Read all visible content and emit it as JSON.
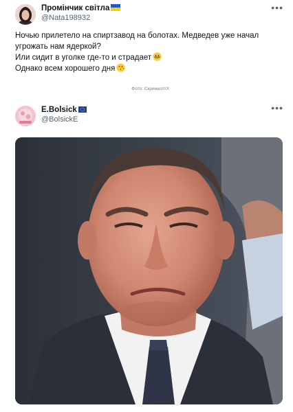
{
  "tweet1": {
    "display_name": "Промінчик світла",
    "handle": "@Nata198932",
    "lines": [
      "Ночью прилетело на спиртзавод на болотах. Медведев уже начал",
      "угрожать нам ядеркой?",
      "Или сидит в уголке где-то и страдает",
      "Однако всем хорошего дня"
    ],
    "emojis": [
      "grinning-face-emoji",
      "winking-kiss-emoji"
    ],
    "photo_credit": "Фото: Скриншот/X",
    "flag_colors": [
      "#1f5cc7",
      "#f5d000"
    ]
  },
  "tweet2": {
    "display_name": "E.Bolsick",
    "handle": "@BolsickE",
    "flag_colors": [
      "#1f3fa8",
      "#f5d000"
    ],
    "image": "photo-of-frowning-man-in-suit"
  },
  "icons": {
    "more": "more-options-icon"
  }
}
